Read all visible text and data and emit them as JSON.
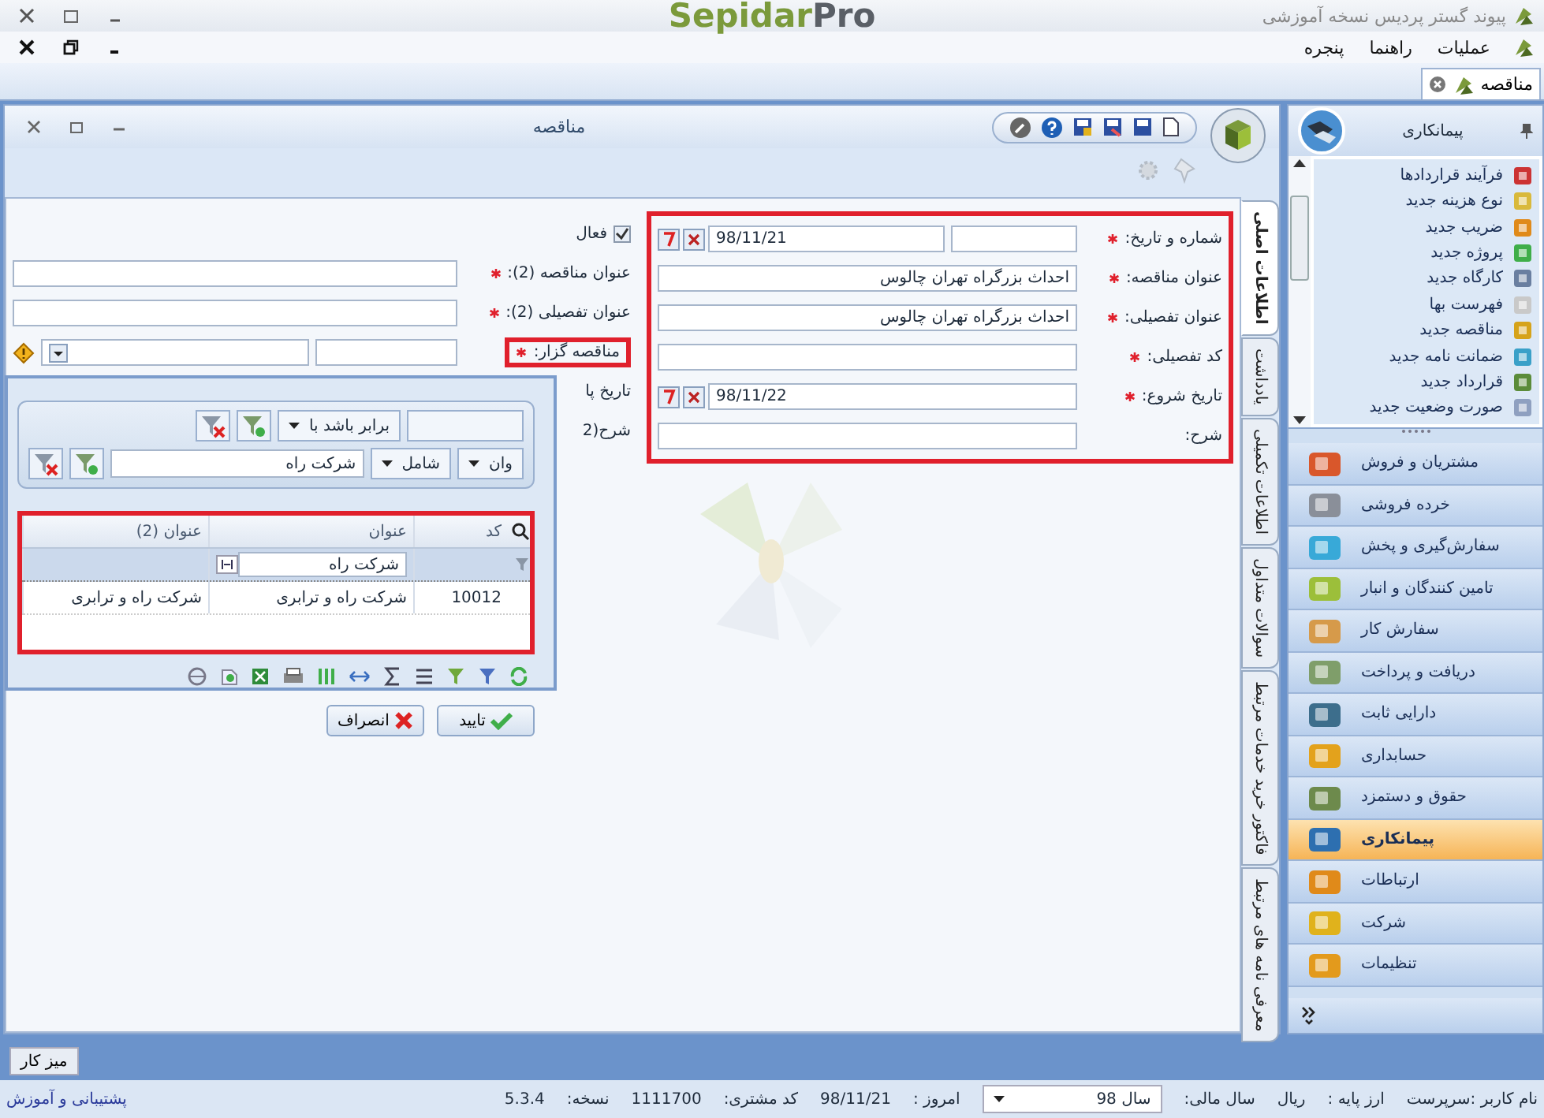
{
  "app": {
    "title": "پیوند گستر پردیس نسخه آموزشی",
    "logo": "Sepidar",
    "logo_suffix": "Pro"
  },
  "menu": [
    "عملیات",
    "راهنما",
    "پنجره"
  ],
  "doc_tabs": [
    {
      "label": "مناقصه",
      "selected": true
    }
  ],
  "window": {
    "title": "مناقصه"
  },
  "vertical_tabs": [
    {
      "label": "اطلاعات اصلی",
      "selected": true
    },
    {
      "label": "یادداشت",
      "selected": false
    },
    {
      "label": "اطلاعات تکمیلی",
      "selected": false
    },
    {
      "label": "سوالات متداول",
      "selected": false
    },
    {
      "label": "فاکتور خرید خدمات مرتبط",
      "selected": false
    },
    {
      "label": "معرفی نامه های مرتبط",
      "selected": false
    }
  ],
  "form": {
    "right_section": {
      "highlighted": true,
      "fields": [
        {
          "kind": "number_date",
          "label": "شماره و تاریخ:",
          "required": true,
          "date": "98/11/21"
        },
        {
          "kind": "text",
          "label": "عنوان مناقصه:",
          "required": true,
          "value": "احداث بزرگراه تهران چالوس"
        },
        {
          "kind": "text",
          "label": "عنوان تفصیلی:",
          "required": true,
          "value": "احداث بزرگراه تهران چالوس"
        },
        {
          "kind": "text",
          "label": "کد تفصیلی:",
          "required": true
        },
        {
          "kind": "date",
          "label": "تاریخ شروع:",
          "required": true,
          "date": "98/11/22"
        },
        {
          "kind": "text",
          "label": "شرح:",
          "required": false
        }
      ]
    },
    "left_section": {
      "fields": [
        {
          "kind": "checkbox",
          "label": "فعال",
          "checked": true
        },
        {
          "kind": "text",
          "label": "عنوان مناقصه (2):",
          "required": true
        },
        {
          "kind": "text",
          "label": "عنوان تفصیلی (2):",
          "required": true
        },
        {
          "kind": "lookup",
          "label": "مناقصه گزار:",
          "required": true,
          "highlighted": true
        },
        {
          "kind": "covered",
          "label": "تاریخ پا"
        },
        {
          "kind": "covered",
          "label": "شرح(2"
        }
      ]
    }
  },
  "lookup_popup": {
    "filters": [
      {
        "operator": "برابر باشد با"
      },
      {
        "field": "وان",
        "operator": "شامل",
        "value": "شرکت راه"
      }
    ],
    "grid": {
      "highlighted": true,
      "columns": [
        "کد",
        "عنوان",
        "عنوان (2)"
      ],
      "filter_value": "شرکت راه",
      "rows": [
        [
          "10012",
          "شرکت راه و ترابری",
          "شرکت راه و ترابری"
        ]
      ]
    },
    "buttons": [
      {
        "label": "تایید",
        "kind": "ok"
      },
      {
        "label": "انصراف",
        "kind": "cancel"
      }
    ]
  },
  "sidebar": {
    "title": "پیمانکاری",
    "items": [
      "فرآیند قراردادها",
      "نوع هزینه جدید",
      "ضریب جدید",
      "پروژه جدید",
      "کارگاه جدید",
      "فهرست بها",
      "مناقصه جدید",
      "ضمانت نامه جدید",
      "قرارداد جدید",
      "صورت وضعیت جدید"
    ],
    "groups": [
      {
        "label": "مشتریان و فروش",
        "selected": false,
        "color": "#d9572b"
      },
      {
        "label": "خرده فروشی",
        "selected": false,
        "color": "#8a8f99"
      },
      {
        "label": "سفارش‌گیری و پخش",
        "selected": false,
        "color": "#38a9d8"
      },
      {
        "label": "تامین کنندگان و انبار",
        "selected": false,
        "color": "#9cbf3a"
      },
      {
        "label": "سفارش کار",
        "selected": false,
        "color": "#d69a4a"
      },
      {
        "label": "دریافت و پرداخت",
        "selected": false,
        "color": "#7f9e6a"
      },
      {
        "label": "دارایی ثابت",
        "selected": false,
        "color": "#3d6e8c"
      },
      {
        "label": "حسابداری",
        "selected": false,
        "color": "#e3a21c"
      },
      {
        "label": "حقوق و دستمزد",
        "selected": false,
        "color": "#6d8a4c"
      },
      {
        "label": "پیمانکاری",
        "selected": true,
        "color": "#2d6fb0"
      },
      {
        "label": "ارتباطات",
        "selected": false,
        "color": "#e08a1a"
      },
      {
        "label": "شرکت",
        "selected": false,
        "color": "#e0b21c"
      },
      {
        "label": "تنظیمات",
        "selected": false,
        "color": "#e39a1c"
      }
    ]
  },
  "taskbar": {
    "button": "میز کار"
  },
  "status_bar": {
    "items": [
      {
        "kind": "text",
        "text": "نام کاربر :سرپرست"
      },
      {
        "kind": "text",
        "text": "ارز پایه :"
      },
      {
        "kind": "text",
        "text": "ریال"
      },
      {
        "kind": "text",
        "text": "سال مالی:"
      },
      {
        "kind": "select",
        "text": "سال 98"
      },
      {
        "kind": "text",
        "text": "امروز :"
      },
      {
        "kind": "text",
        "text": "98/11/21"
      },
      {
        "kind": "text",
        "text": "کد مشتری:"
      },
      {
        "kind": "text",
        "text": "1111700"
      },
      {
        "kind": "text",
        "text": "نسخه:"
      },
      {
        "kind": "text",
        "text": "5.3.4"
      }
    ],
    "link": "پشتیبانی و آموزش"
  }
}
